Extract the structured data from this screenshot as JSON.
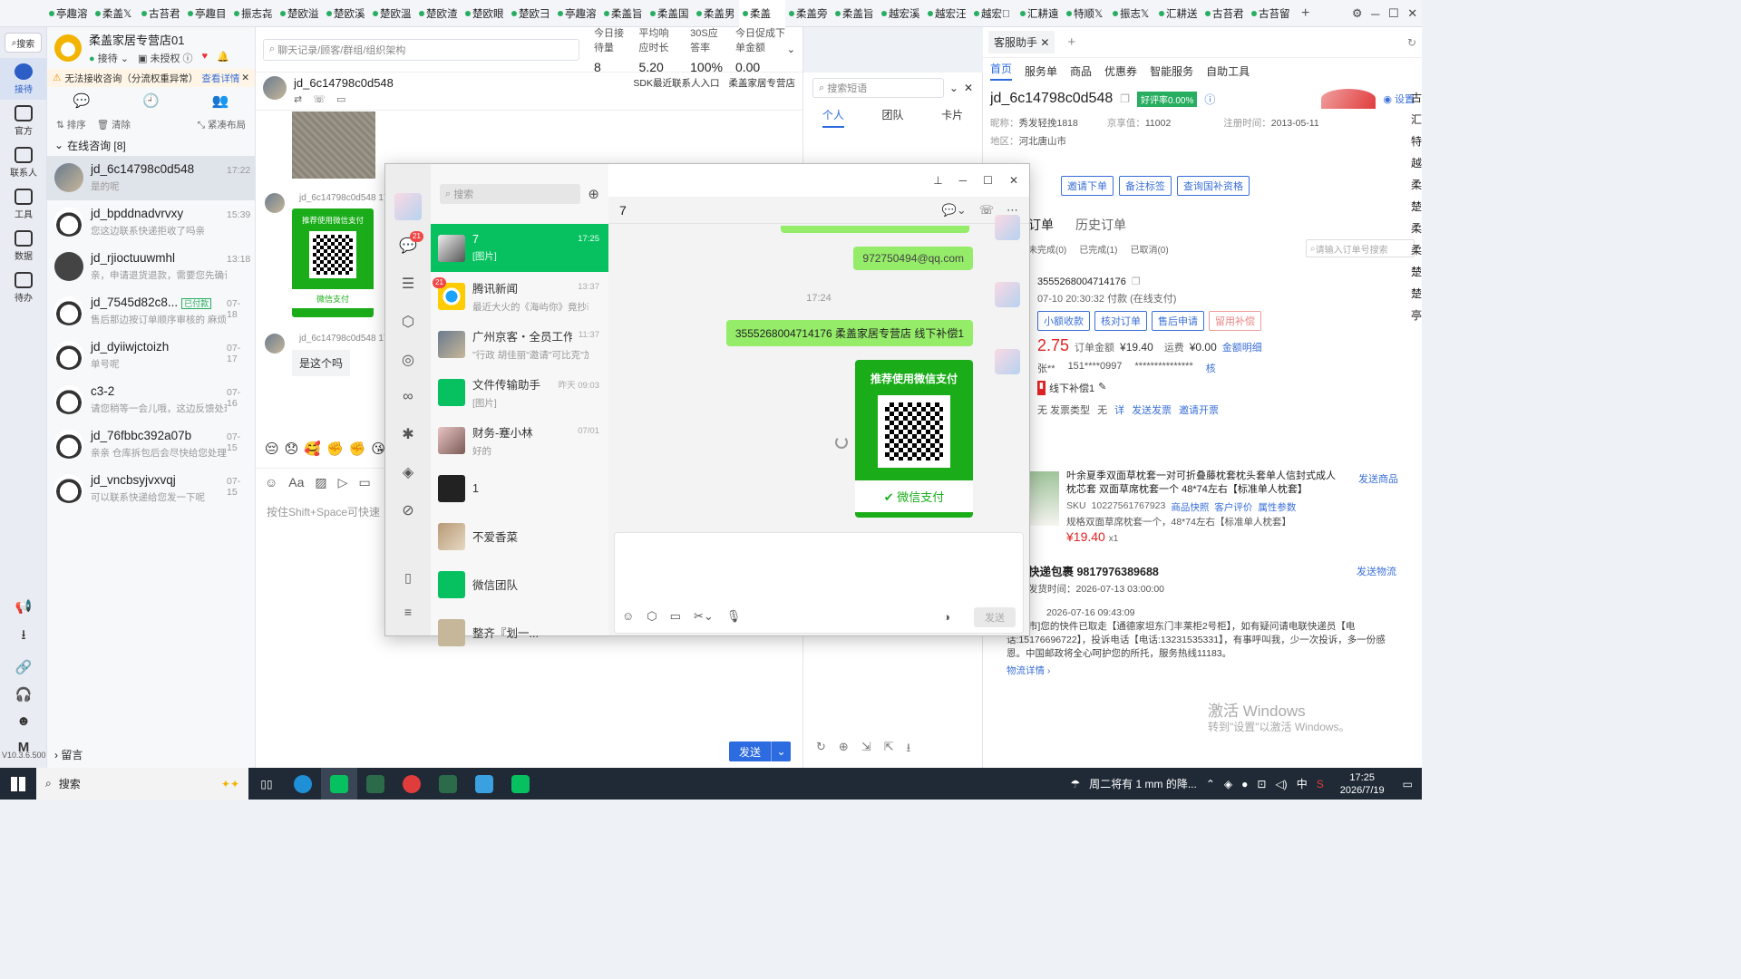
{
  "tabs": [
    "亭趣溶",
    "柔盖𝕏",
    "古苔君",
    "亭趣目",
    "振志㐂",
    "楚欧溢",
    "楚欧溪",
    "楚欧溫",
    "楚欧渣",
    "楚欧眼",
    "楚欧彐",
    "亭趣溶",
    "柔盖旨",
    "柔盖国",
    "柔盖男",
    "柔盖",
    "柔盖旁",
    "柔盖旨",
    "越宏溪",
    "越宏汪",
    "越宏𥨊",
    "汇耕遠",
    "特顺𝕏",
    "振志𝕏",
    "汇耕送",
    "古苔君",
    "古苔留"
  ],
  "active_tab_index": 15,
  "rail": {
    "search": "搜索",
    "items": [
      "接待",
      "官方",
      "联系人",
      "工具",
      "数据",
      "待办"
    ],
    "version": "V10.3.6.500",
    "m": "M"
  },
  "shop": {
    "name": "柔盖家居专营店01",
    "status": "接待",
    "auth": "未授权",
    "warning": "无法接收咨询（分流权重异常）",
    "warning_link": "查看详情",
    "tools": [
      "排序",
      "清除",
      "紧凑布局"
    ],
    "group": "在线咨询 [8]",
    "leave": "留言"
  },
  "conversations": [
    {
      "name": "jd_6c14798c0d548",
      "preview": "是的呢",
      "time": "17:22",
      "tag": ""
    },
    {
      "name": "jd_bpddnadvrvxy",
      "preview": "您这边联系快递拒收了吗亲",
      "time": "15:39",
      "tag": ""
    },
    {
      "name": "jd_rjioctuuwmhl",
      "preview": "亲，申请退货退款，需要您先确认...",
      "time": "13:18",
      "tag": ""
    },
    {
      "name": "jd_7545d82c8...",
      "preview": "售后那边按订单顺序审核的 麻烦...",
      "time": "07-18",
      "tag": "已付款"
    },
    {
      "name": "jd_dyiiwjctoizh",
      "preview": "单号呢",
      "time": "07-17",
      "tag": ""
    },
    {
      "name": "c3-2",
      "preview": "请您稍等一会儿哦，这边反馈处理...",
      "time": "07-16",
      "tag": ""
    },
    {
      "name": "jd_76fbbc392a07b",
      "preview": "亲亲 仓库拆包后会尽快给您处理...",
      "time": "07-15",
      "tag": ""
    },
    {
      "name": "jd_vncbsyjvxvqj",
      "preview": "可以联系快递给您发一下呢",
      "time": "07-15",
      "tag": ""
    }
  ],
  "chat": {
    "search_placeholder": "聊天记录/顾客/群组/组织架构",
    "stats": [
      {
        "label": "今日接待量",
        "value": "8"
      },
      {
        "label": "平均响应时长",
        "value": "5.20"
      },
      {
        "label": "30S应答率",
        "value": "100%"
      },
      {
        "label": "今日促成下单金额",
        "value": "0.00"
      }
    ],
    "customer": "jd_6c14798c0d548",
    "sdk": "SDK最近联系人入口",
    "shop": "柔盖家居专营店",
    "msg_sender": "jd_6c14798c0d548",
    "msg_time": "17:2",
    "pay_title": "推荐使用微信支付",
    "pay_label": "微信支付",
    "text_msg": "是这个吗",
    "input_hint": "按住Shift+Space可快速",
    "send": "发送",
    "watermark": "柔盖家居专营店"
  },
  "phrases": {
    "placeholder": "搜索短语",
    "tabs": [
      "个人",
      "团队",
      "卡片"
    ]
  },
  "panel": {
    "title": "客服助手",
    "top_tabs": [
      "首页",
      "服务单",
      "商品",
      "优惠券",
      "智能服务",
      "自助工具"
    ],
    "customer_id": "jd_6c14798c0d548",
    "rate": "好评率0.00%",
    "settings": "设置",
    "nickname_label": "昵称：",
    "nickname": "秀发轻挽1818",
    "jx_label": "京享值：",
    "jx": "11002",
    "reg_label": "注册时间：",
    "reg": "2013-05-11",
    "region_label": "地区：",
    "region": "河北唐山市",
    "actions": [
      "邀请下单",
      "备注标签",
      "查询国补资格"
    ],
    "order_tabs": [
      "订单",
      "历史订单"
    ],
    "order_sub": [
      "未完成(0)",
      "已完成(1)",
      "已取消(0)"
    ],
    "order_search": "请输入订单号搜索",
    "order_no": "3555268004714176",
    "order_time": "07-10 20:30:32 付款  (在线支付)",
    "order_btns": [
      "小额收款",
      "核对订单",
      "售后申请",
      "留用补偿"
    ],
    "price": "2.75",
    "order_amount_label": "订单金额",
    "order_amount": "¥19.40",
    "freight_label": "运费",
    "freight": "¥0.00",
    "amount_detail": "金额明细",
    "buyer": "张**",
    "phone": "151****0997",
    "masked": "***************",
    "verify": "核",
    "offline": "线下补偿1",
    "invoice_label": "无   发票类型",
    "invoice": "无",
    "invoice_detail": "详",
    "send_invoice": "发送发票",
    "open_invoice": "邀请开票",
    "product_name": "叶余夏季双面草枕套一对可折叠藤枕套枕头套单人信封式成人枕芯套 双面草席枕套一个 48*74左右【标准单人枕套】",
    "send_product": "发送商品",
    "sku_label": "SKU",
    "sku": "10227561767923",
    "snapshot": "商品快照",
    "review": "客户评价",
    "attr": "属性参数",
    "spec": "规格双面草席枕套一个，48*74左右【标准单人枕套】",
    "product_price": "¥19.40",
    "qty": "x1",
    "express": "快递包裹 9817976389688",
    "send_logistics": "发送物流",
    "ship_time_label": "发货时间：",
    "ship_time": "2026-07-13 03:00:00",
    "track_time": "2026-07-16 09:43:09",
    "track_text": "[邢台市]您的快件已取走【通德家坦东门丰莱柜2号柜】，如有疑问请电联快递员【电话:15176696722】，投诉电话【电话:13231535331】，有事呼叫我，少一次投诉，多一份感恩。中国邮政将全心呵护您的所托，服务热线11183。",
    "logistics_detail": "物流详情",
    "right_chars": [
      "古",
      "汇",
      "特",
      "越",
      "柔",
      "楚",
      "柔",
      "柔",
      "楚",
      "楚",
      "亭"
    ],
    "activate_title": "激活 Windows",
    "activate_sub": "转到\"设置\"以激活 Windows。"
  },
  "wechat": {
    "search": "搜索",
    "chat_title": "7",
    "nav_badge": "21",
    "list": [
      {
        "name": "7",
        "preview": "[图片]",
        "time": "17:25",
        "badge": ""
      },
      {
        "name": "腾讯新闻",
        "preview": "最近大火的《海屿你》竟抄袭...",
        "time": "13:37",
        "badge": "21"
      },
      {
        "name": "广州京客・全员工作...",
        "preview": "\"行政 胡佳丽\"邀请\"可比克\"加...",
        "time": "11:37",
        "badge": ""
      },
      {
        "name": "文件传输助手",
        "preview": "[图片]",
        "time": "昨天 09:03",
        "badge": ""
      },
      {
        "name": "财务-蹇小林",
        "preview": "好的",
        "time": "07/01",
        "badge": ""
      },
      {
        "name": "1",
        "preview": "",
        "time": "",
        "badge": ""
      },
      {
        "name": "不爱香菜",
        "preview": "",
        "time": "",
        "badge": ""
      },
      {
        "name": "微信团队",
        "preview": "",
        "time": "",
        "badge": ""
      },
      {
        "name": "整齐『划一...",
        "preview": "",
        "time": "",
        "badge": ""
      }
    ],
    "msgs": {
      "email": "972750494@qq.com",
      "time": "17:24",
      "order": "3555268004714176  柔盖家居专营店  线下补偿1",
      "pay_title": "推荐使用微信支付",
      "pay_label": "微信支付"
    },
    "send": "发送"
  },
  "taskbar": {
    "search": "搜索",
    "weather": "周二将有 1 mm 的降...",
    "ime": "中",
    "time": "17:25",
    "date": "2026/7/19"
  },
  "colors": {
    "accent": "#2d6be0",
    "wechat_green": "#07c160",
    "bubble_green": "#95ec69",
    "price_red": "#e02424"
  }
}
